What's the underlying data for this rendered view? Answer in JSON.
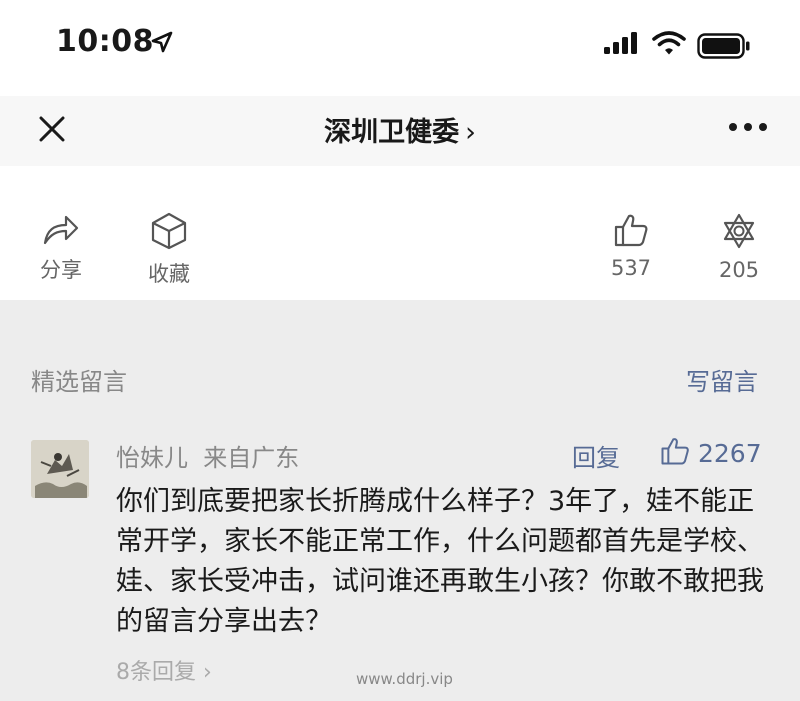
{
  "status_bar": {
    "time": "10:08",
    "icons": [
      "location-arrow-icon",
      "signal-icon",
      "wifi-icon",
      "battery-icon"
    ]
  },
  "nav": {
    "title": "深圳卫健委",
    "chevron": "›",
    "icons": [
      "close-icon",
      "more-icon"
    ]
  },
  "actions": {
    "share": {
      "label": "分享",
      "icon": "share-icon"
    },
    "favorite": {
      "label": "收藏",
      "icon": "cube-icon"
    },
    "like": {
      "count": "537",
      "icon": "thumbs-up-icon"
    },
    "wow": {
      "count": "205",
      "icon": "star-icon"
    }
  },
  "comments_section": {
    "title": "精选留言",
    "write_label": "写留言"
  },
  "comment": {
    "author": "怡妹儿",
    "location": "来自广东",
    "reply_label": "回复",
    "likes": "2267",
    "text": "你们到底要把家长折腾成什么样子？3年了，娃不能正常开学，家长不能正常工作，什么问题都首先是学校、娃、家长受冲击，试问谁还再敢生小孩？你敢不敢把我的留言分享出去？",
    "replies_label": "8条回复"
  },
  "watermark": "www.ddrj.vip",
  "colors": {
    "link": "#576b95",
    "background": "#ededed",
    "top_background": "#ffffff",
    "nav_background": "#f7f7f7"
  }
}
